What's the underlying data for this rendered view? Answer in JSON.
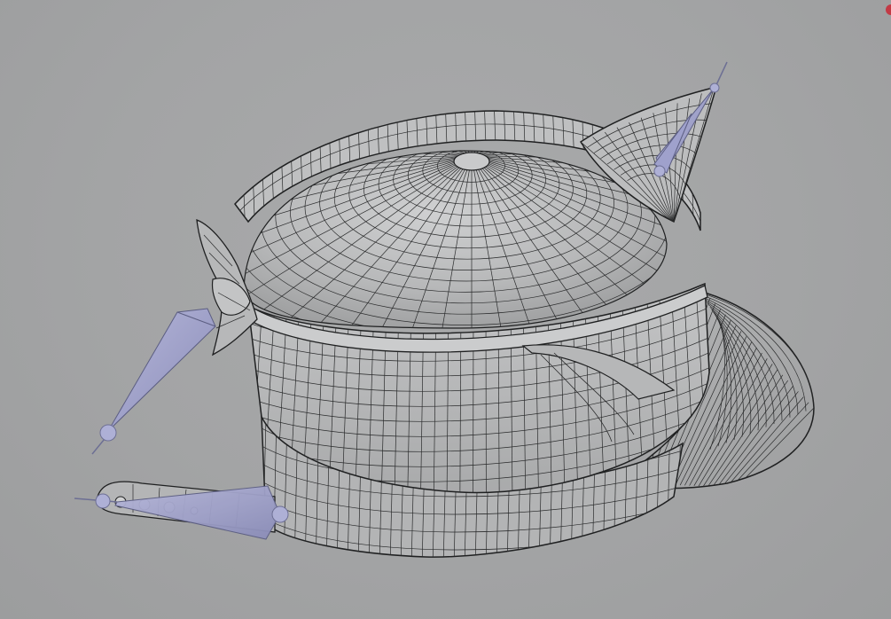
{
  "viewport": {
    "background": "#a3a4a5",
    "model_fill": "#b9babb",
    "model_dark": "#8f9091",
    "wire_color": "#2a2b2c",
    "bone_color": "#9ea0c6"
  },
  "indicators": {
    "corner_dot_color": "#c23a45"
  }
}
